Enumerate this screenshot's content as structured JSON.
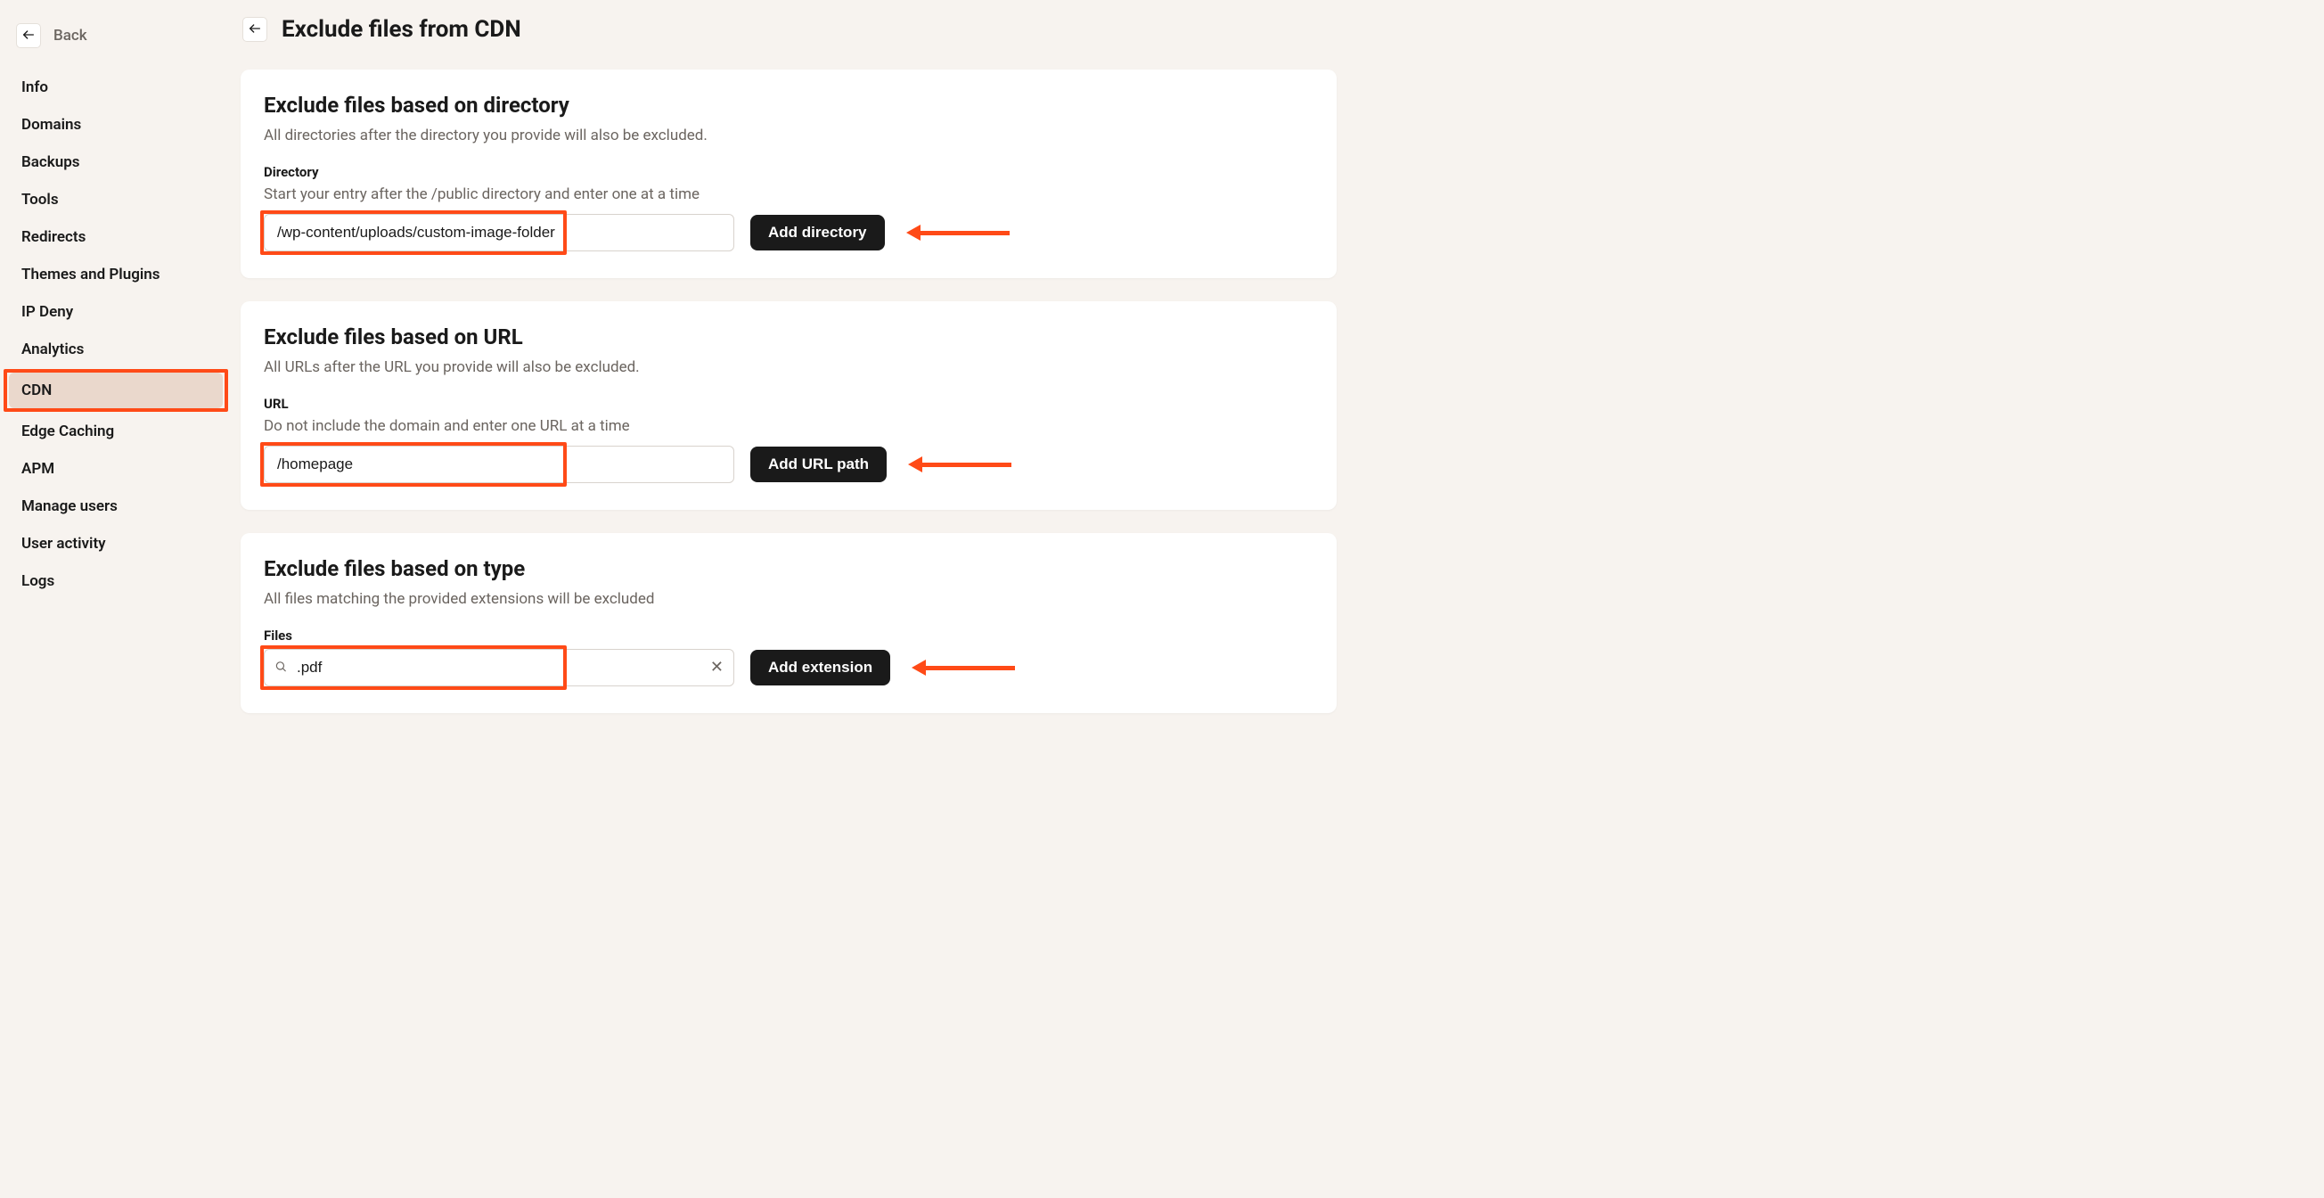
{
  "back": {
    "label": "Back"
  },
  "sidebar": {
    "items": [
      {
        "id": "info",
        "label": "Info"
      },
      {
        "id": "domains",
        "label": "Domains"
      },
      {
        "id": "backups",
        "label": "Backups"
      },
      {
        "id": "tools",
        "label": "Tools"
      },
      {
        "id": "redirects",
        "label": "Redirects"
      },
      {
        "id": "themes-and-plugins",
        "label": "Themes and Plugins"
      },
      {
        "id": "ip-deny",
        "label": "IP Deny"
      },
      {
        "id": "analytics",
        "label": "Analytics"
      },
      {
        "id": "cdn",
        "label": "CDN",
        "active": true
      },
      {
        "id": "edge-caching",
        "label": "Edge Caching"
      },
      {
        "id": "apm",
        "label": "APM"
      },
      {
        "id": "manage-users",
        "label": "Manage users"
      },
      {
        "id": "user-activity",
        "label": "User activity"
      },
      {
        "id": "logs",
        "label": "Logs"
      }
    ]
  },
  "page": {
    "title": "Exclude files from CDN"
  },
  "sections": {
    "directory": {
      "title": "Exclude files based on directory",
      "desc": "All directories after the directory you provide will also be excluded.",
      "field_label": "Directory",
      "field_hint": "Start your entry after the /public directory and enter one at a time",
      "input_value": "/wp-content/uploads/custom-image-folder",
      "button_label": "Add directory"
    },
    "url": {
      "title": "Exclude files based on URL",
      "desc": "All URLs after the URL you provide will also be excluded.",
      "field_label": "URL",
      "field_hint": "Do not include the domain and enter one URL at a time",
      "input_value": "/homepage",
      "button_label": "Add URL path"
    },
    "type": {
      "title": "Exclude files based on type",
      "desc": "All files matching the provided extensions will be excluded",
      "field_label": "Files",
      "input_value": ".pdf",
      "button_label": "Add extension"
    }
  },
  "annotations": {
    "color": "#ff4a17"
  }
}
